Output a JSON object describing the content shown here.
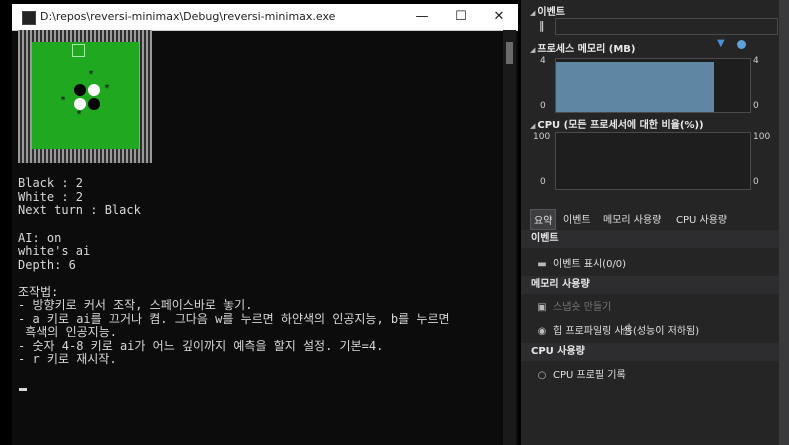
{
  "console": {
    "title": "D:\\repos\\reversi-minimax\\Debug\\reversi-minimax.exe",
    "minimize_glyph": "—",
    "maximize_glyph": "☐",
    "close_glyph": "✕",
    "hint_glyph": "*",
    "lines": {
      "black": "Black : 2",
      "white": "White : 2",
      "next": "Next turn : Black",
      "ai": "AI: on",
      "ai_side": "white's ai",
      "depth": "Depth: 6",
      "ops_title": "조작법:",
      "op1": "- 방향키로 커서 조작, 스페이스바로 놓기.",
      "op2a": "- a 키로 ai를 끄거나 켬. 그다음 w를 누르면 하얀색의 인공지능, b를 누르면",
      "op2b": " 흑색의 인공지능.",
      "op3": "- 숫자 4-8 키로 ai가 어느 깊이까지 예측을 할지 설정. 기본=4.",
      "op4": "- r 키로 재시작."
    }
  },
  "diagnostics": {
    "events_label": "이벤트",
    "pause_glyph": "‖",
    "process_memory_label": "프로세스 메모리 (MB)",
    "mem_ytop": "4",
    "mem_ybottom": "0",
    "cpu_label": "CPU (모든 프로세서에 대한 비율(%))",
    "cpu_ytop": "100",
    "cpu_ybottom": "0",
    "tabs": [
      "요약",
      "이벤트",
      "메모리 사용량",
      "CPU 사용량"
    ],
    "events_header": "이벤트",
    "show_events": "이벤트 표시(0/0)",
    "memory_header": "메모리 사용량",
    "take_snapshot": "스냅숏 만들기",
    "heap_profiling": "힙 프로파일링 사용(성능이 저하됨)",
    "cpu_header": "CPU 사용량",
    "cpu_record": "CPU 프로필 기록",
    "accent_color": "#5f86a3"
  }
}
